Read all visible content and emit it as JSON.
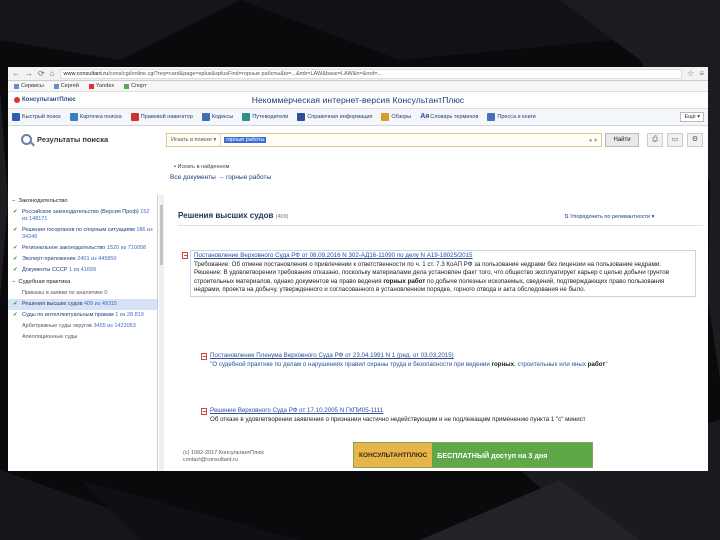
{
  "browser": {
    "url_host": "www.consultant.ru",
    "url_path": "/cons/cgi/online.cgi?req=card&page=splus&splusFind=горные работы&ts=...&mb=LAW&base=LAW&n=&rnd=...",
    "bookmarks": [
      "Сервисы",
      "Сергей",
      "Yandex",
      "Спорт"
    ]
  },
  "header": {
    "logo": "КонсультантПлюс",
    "title": "Некоммерческая интернет-версия КонсультантПлюс"
  },
  "toolbar": {
    "items": [
      "Быстрый поиск",
      "Карточка поиска",
      "Правовой навигатор",
      "Кодексы",
      "Путеводители",
      "Справочная информация",
      "Обзоры",
      "Словарь терминов",
      "Пресса и книги"
    ],
    "more": "Ещё"
  },
  "search": {
    "results_title": "Результаты поиска",
    "scope": "Искать в поиске",
    "query": "горные работы",
    "find_label": "Найти",
    "found_in": "Искать в найденном",
    "crumb_all": "Все документы",
    "crumb_arrow": "→",
    "crumb_query": "горные работы"
  },
  "sidebar": {
    "law_group": "Законодательство",
    "law_items": [
      {
        "label": "Российское законодательство (Версия Проф)",
        "count": "152 из 148171"
      },
      {
        "label": "Решения госорганов по спорным ситуациям",
        "count": "186 из 34246"
      },
      {
        "label": "Региональное законодательство",
        "count": "1520 из 710058"
      },
      {
        "label": "Эксперт-приложение",
        "count": "2401 из 445850"
      },
      {
        "label": "Документы СССР",
        "count": "1 из 41699"
      }
    ],
    "court_group": "Судебная практика",
    "court_items": [
      {
        "label": "Приказы и заявки по аналитике",
        "count": "0"
      },
      {
        "label": "Решения высших судов",
        "count": "409 из 49315"
      },
      {
        "label": "Суды по интеллектуальным правам",
        "count": "1 из 28 819"
      },
      {
        "label": "Арбитражные суды округов",
        "count": "3455 из 1423053"
      },
      {
        "label": "Апелляционные суды",
        "count": ""
      }
    ]
  },
  "main": {
    "section_title": "Решения высших судов",
    "section_count": "(409)",
    "sort_label": "Упорядочить по релевантности",
    "docs": [
      {
        "title": "Постановление Верховного Суда РФ от 08.09.2016 N 302-АД16-11090 по делу N А19-18025/2015",
        "line1": "Требование: Об отмене постановления о привлечении к ответственности по ч. 1 ст. 7.3 КоАП РФ за пользование недрами без лицензии на пользование недрами.",
        "line2a": "Решение: В удовлетворении требования отказано, поскольку материалами дела установлен факт того, что общество эксплуатирует карьер с целью добычи грунтов строительных материалов, однако документов на право ведения ",
        "hl1": "горных работ",
        "line2b": " по добыче полезных ископаемых, сведений, подтверждающих право пользования недрами, проекта на добычу, утвержденного и согласованного в установленном порядке, горного отвода и акта обследования не было."
      },
      {
        "title": "Постановление Пленума Верховного Суда РФ от 23.04.1991 N 1 (ред. от 03.03.2015)",
        "line1a": "\"О судебной практике по делам о нарушениях правил охраны труда и безопасности при ведении ",
        "hl1": "горных",
        "line1b": ", строительных или иных ",
        "hl2": "работ",
        "line1c": "\""
      },
      {
        "title": "Решение Верховного Суда РФ от 17.10.2005 N ГКПИ05-1111",
        "line1": "Об отказе в удовлетворении заявления о признании частично недействующим и не подлежащим применению пункта 1 \"с\" минист"
      }
    ]
  },
  "footer": {
    "copyright": "(c) 1992-2017 КонсультантПлюс",
    "contact": "contact@consultant.ru"
  },
  "banner": {
    "left": "КОНСУЛЬТАНТПЛЮС",
    "right": "БЕСПЛАТНЫЙ доступ на 3 дня"
  }
}
